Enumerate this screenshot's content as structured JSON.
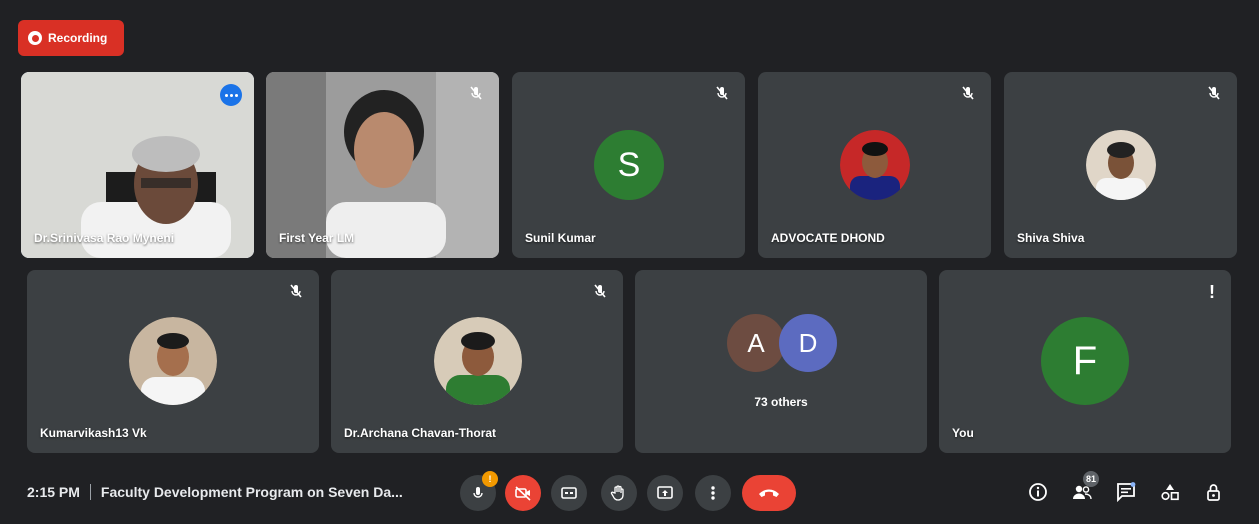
{
  "recording": {
    "label": "Recording"
  },
  "tiles": [
    {
      "name": "Dr.Srinivasa Rao Myneni"
    },
    {
      "name": "First Year LM"
    },
    {
      "name": "Sunil Kumar",
      "initial": "S",
      "color": "#2d7d32"
    },
    {
      "name": "ADVOCATE DHOND"
    },
    {
      "name": "Shiva Shiva"
    },
    {
      "name": "Kumarvikash13 Vk"
    },
    {
      "name": "Dr.Archana Chavan-Thorat"
    },
    {
      "name": "73 others",
      "initials": [
        "A",
        "D"
      ],
      "colors": [
        "#6d4c41",
        "#5c6bc0"
      ]
    },
    {
      "name": "You",
      "initial": "F",
      "color": "#2d7d32"
    }
  ],
  "bottom_bar": {
    "time": "2:15 PM",
    "meeting_title": "Faculty Development Program on Seven Da...",
    "mic_badge": "!",
    "people_count": "81"
  },
  "colors": {
    "accent": "#1a73e8",
    "danger": "#ea4335",
    "tile": "#3c4043",
    "bg": "#202124"
  }
}
